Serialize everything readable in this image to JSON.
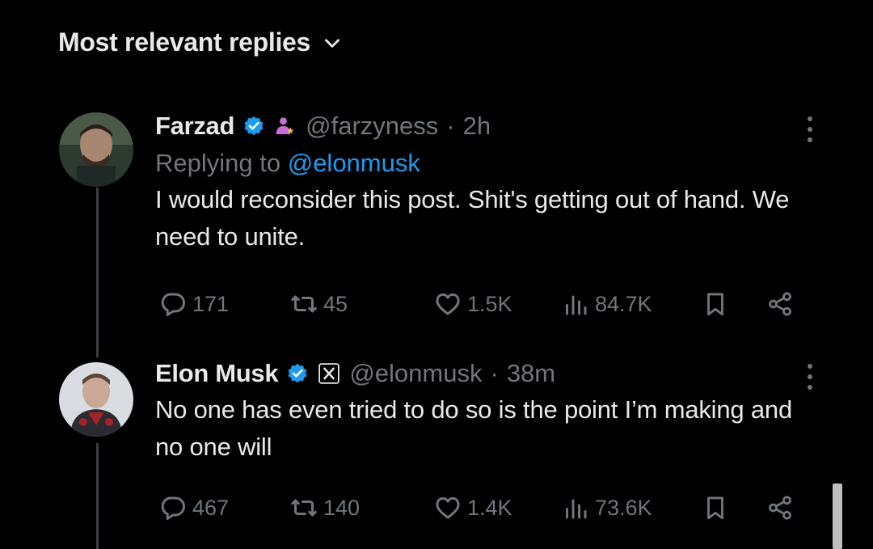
{
  "header": {
    "sort_label": "Most relevant replies"
  },
  "tweets": [
    {
      "display_name": "Farzad",
      "handle": "@farzyness",
      "separator": "·",
      "time": "2h",
      "replying_prefix": "Replying to",
      "replying_to": "@elonmusk",
      "text": "I would reconsider this post. Shit's getting out of hand. We need to unite.",
      "replies": "171",
      "reposts": "45",
      "likes": "1.5K",
      "views": "84.7K",
      "badge_icon": "subscriber-badge-icon"
    },
    {
      "display_name": "Elon Musk",
      "handle": "@elonmusk",
      "separator": "·",
      "time": "38m",
      "text": "No one has even tried to do so is the point I’m making and no one will",
      "replies": "467",
      "reposts": "140",
      "likes": "1.4K",
      "views": "73.6K",
      "badge_icon": "x-affiliate-badge-icon"
    }
  ],
  "colors": {
    "background": "#000000",
    "text": "#e7e9ea",
    "muted": "#71767b",
    "link": "#1d9bf0",
    "verified": "#1d9bf0"
  }
}
